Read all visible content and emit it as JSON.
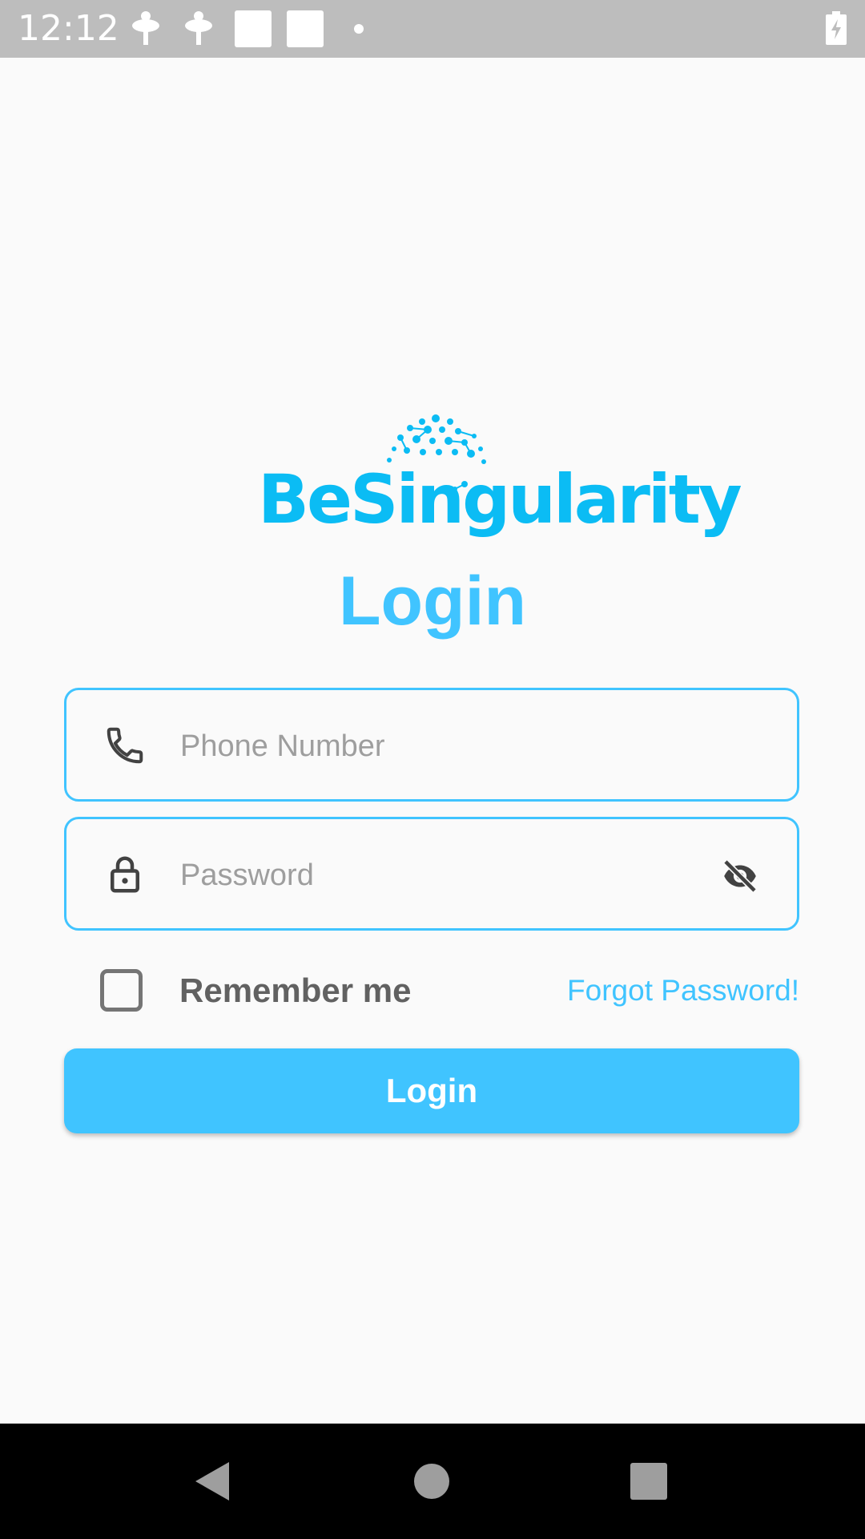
{
  "status_bar": {
    "time": "12:12",
    "icons": [
      "notification-icon",
      "notification-icon",
      "app-notification-icon",
      "app-notification-icon",
      "more-notifications-dot",
      "battery-charging-icon"
    ]
  },
  "logo": {
    "text": "BeSingularity",
    "color": "#0bbcf4"
  },
  "title": "Login",
  "form": {
    "phone": {
      "placeholder": "Phone Number",
      "value": "",
      "icon": "phone-icon"
    },
    "password": {
      "placeholder": "Password",
      "value": "",
      "icon": "lock-icon",
      "toggle_icon": "visibility-off-icon"
    },
    "remember_label": "Remember me",
    "remember_checked": false,
    "forgot_label": "Forgot Password!",
    "submit_label": "Login"
  },
  "colors": {
    "accent": "#40c4ff",
    "background": "#fafafa",
    "status_bar": "#bdbdbd",
    "nav_bar": "#000000"
  },
  "nav_bar": {
    "buttons": [
      "back-icon",
      "home-icon",
      "recents-icon"
    ]
  }
}
